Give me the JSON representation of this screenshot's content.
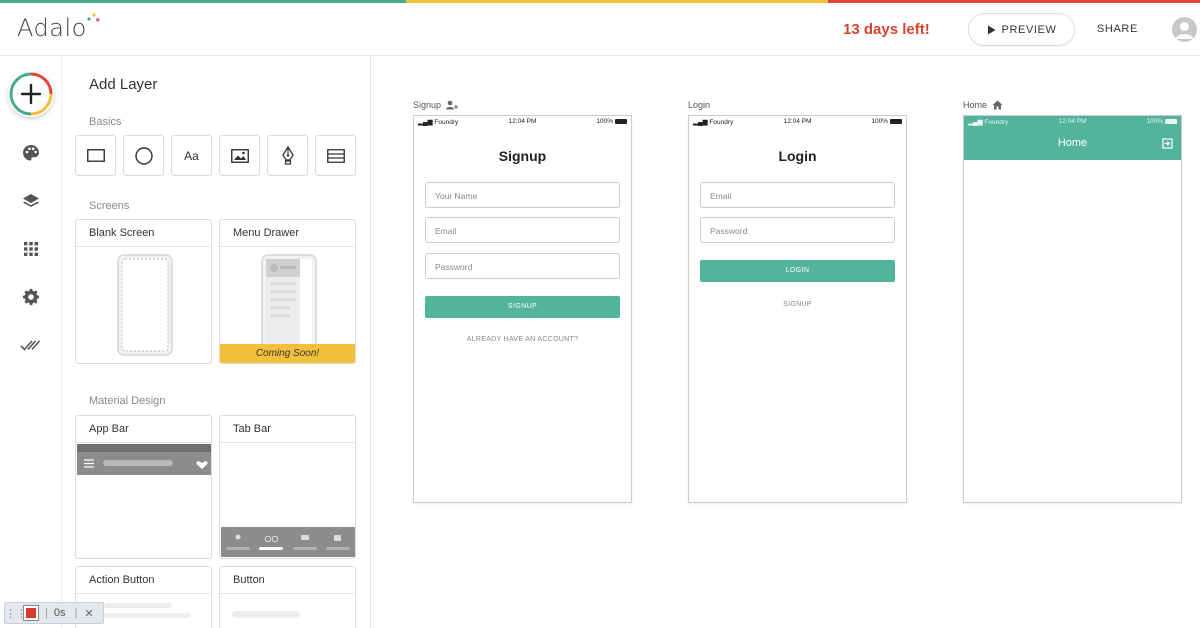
{
  "colors": {
    "stripe": [
      "#4aaa8f",
      "#f3c03c",
      "#e0473a"
    ],
    "accent": "#52b49a",
    "trial": "#d9432c",
    "coming_soon": "#f3c03c"
  },
  "header": {
    "logo_text": "Adalo",
    "trial_text": "13 days left!",
    "preview_label": "PREVIEW",
    "share_label": "SHARE",
    "avatar_icon": "user-icon"
  },
  "rail": {
    "items": [
      "add-icon",
      "palette-icon",
      "layers-icon",
      "grid-icon",
      "gear-icon",
      "double-check-icon"
    ]
  },
  "panel": {
    "title": "Add Layer",
    "basics_label": "Basics",
    "basics": [
      {
        "icon": "rectangle-icon"
      },
      {
        "icon": "ellipse-icon"
      },
      {
        "icon": "text-icon",
        "text": "Aa"
      },
      {
        "icon": "image-icon"
      },
      {
        "icon": "pen-icon"
      },
      {
        "icon": "list-icon"
      }
    ],
    "screens_label": "Screens",
    "screens": [
      {
        "label": "Blank Screen"
      },
      {
        "label": "Menu Drawer",
        "badge": "Coming Soon!"
      }
    ],
    "material_label": "Material Design",
    "material": [
      {
        "label": "App Bar"
      },
      {
        "label": "Tab Bar"
      },
      {
        "label": "Action Button"
      },
      {
        "label": "Button"
      }
    ]
  },
  "recorder": {
    "time": "0s"
  },
  "canvas": {
    "status": {
      "carrier": "Foundry",
      "time": "12:04 PM",
      "battery": "100%"
    },
    "signup": {
      "label": "Signup",
      "title": "Signup",
      "fields": [
        "Your Name",
        "Email",
        "Password"
      ],
      "button": "SIGNUP",
      "link": "ALREADY HAVE AN ACCOUNT?"
    },
    "login": {
      "label": "Login",
      "title": "Login",
      "fields": [
        "Email",
        "Password"
      ],
      "button": "LOGIN",
      "link": "SIGNUP"
    },
    "home": {
      "label": "Home",
      "title": "Home"
    }
  }
}
